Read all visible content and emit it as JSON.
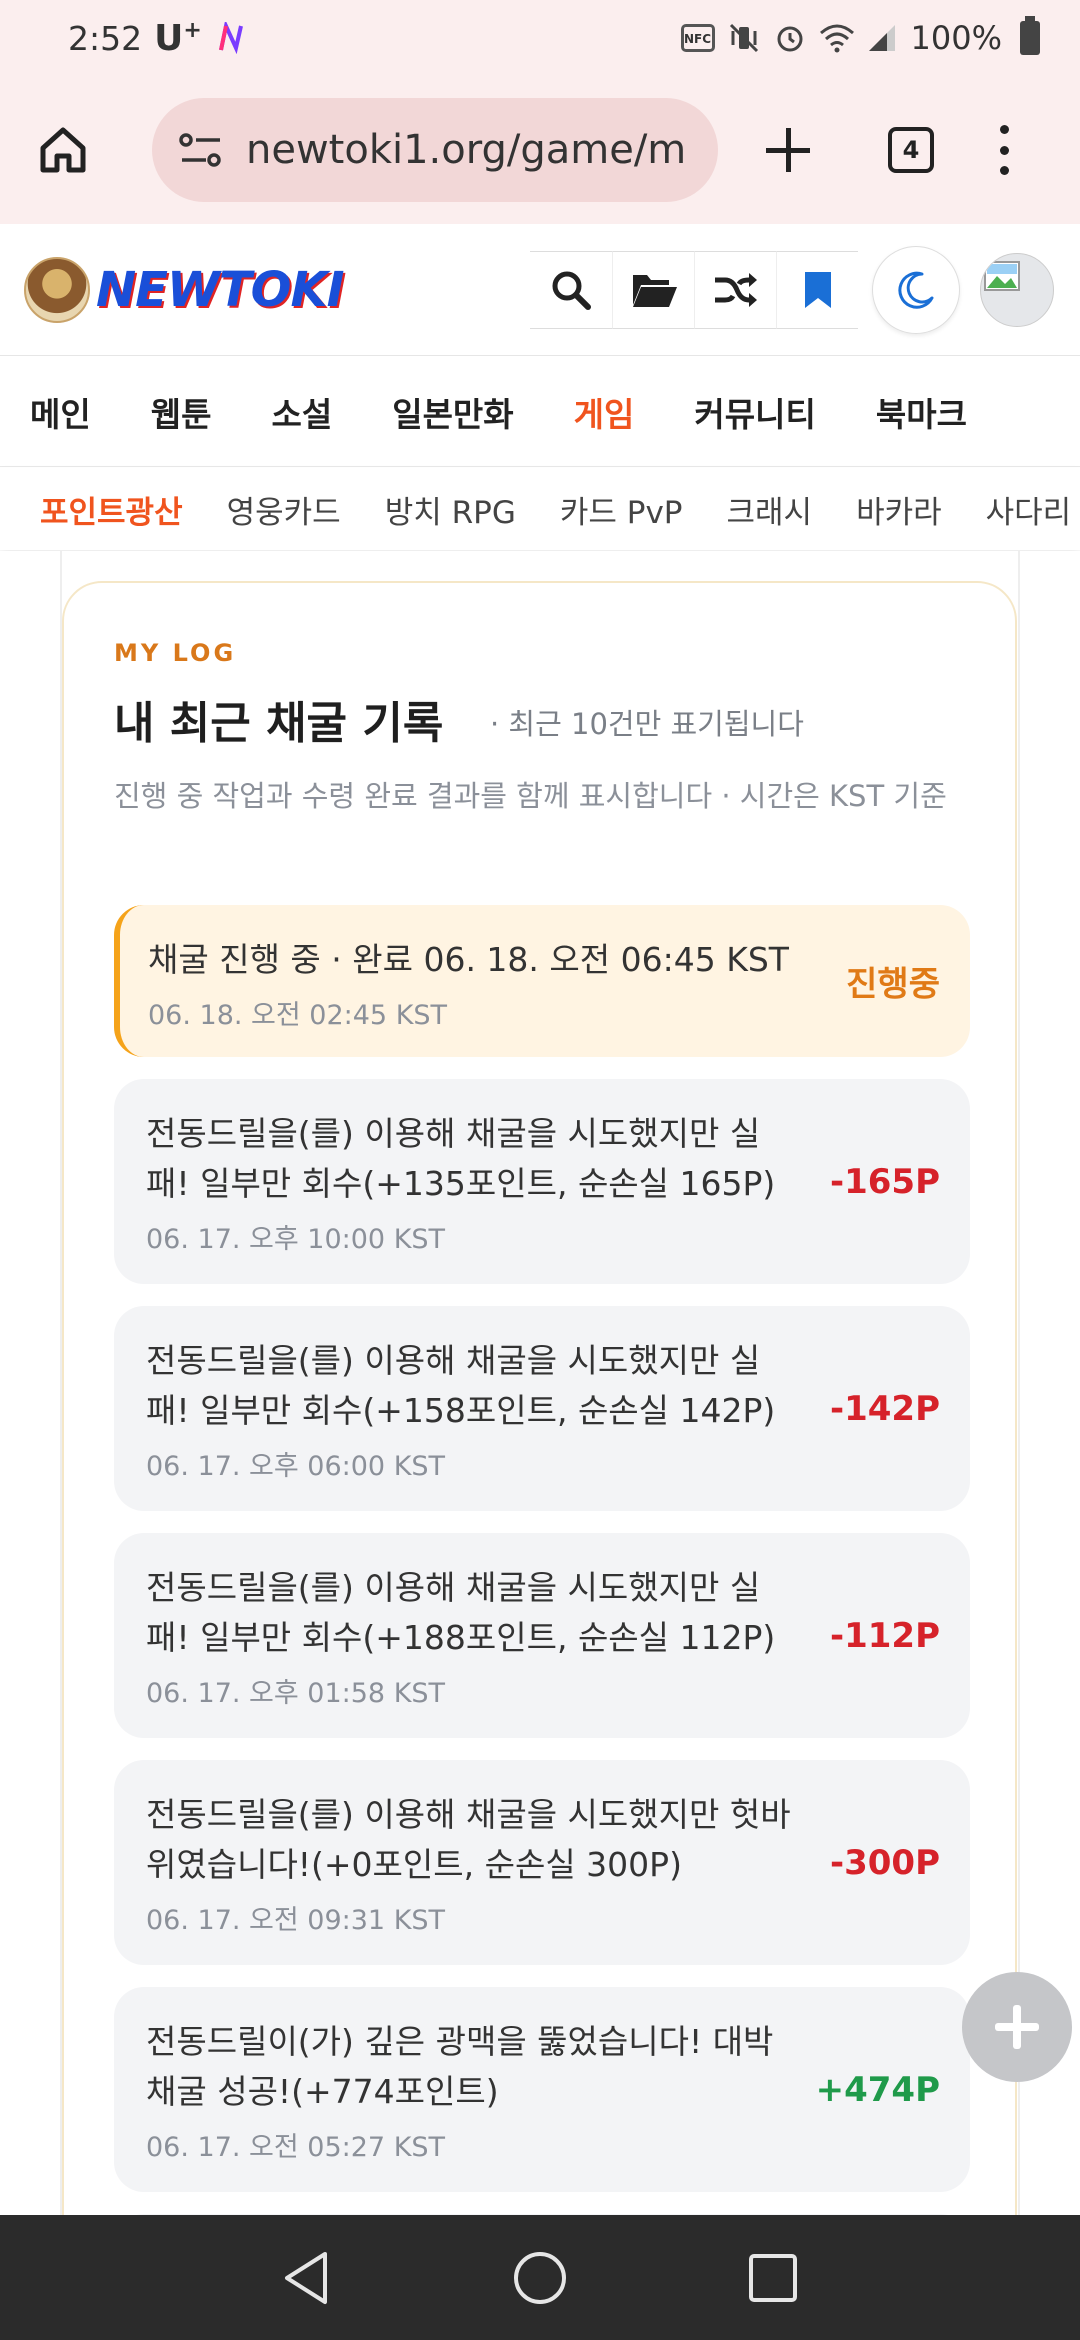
{
  "status_bar": {
    "time": "2:52",
    "carrier": "U",
    "carrier_suffix": "+",
    "battery": "100%"
  },
  "browser": {
    "url": "newtoki1.org/game/m",
    "tab_count": "4"
  },
  "site": {
    "logo_text": "NEWTOKI"
  },
  "main_nav": [
    {
      "label": "메인"
    },
    {
      "label": "웹툰"
    },
    {
      "label": "소설"
    },
    {
      "label": "일본만화"
    },
    {
      "label": "게임"
    },
    {
      "label": "커뮤니티"
    },
    {
      "label": "북마크"
    }
  ],
  "main_nav_active": "게임",
  "sub_nav": [
    {
      "label": "포인트광산"
    },
    {
      "label": "영웅카드"
    },
    {
      "label": "방치 RPG"
    },
    {
      "label": "카드 PvP"
    },
    {
      "label": "크래시"
    },
    {
      "label": "바카라"
    },
    {
      "label": "사다리"
    }
  ],
  "sub_nav_active": "포인트광산",
  "log": {
    "eyebrow": "MY LOG",
    "title": "내 최근 채굴 기록",
    "title_note": "· 최근 10건만 표기됩니다",
    "description": "진행 중 작업과 수령 완료 결과를 함께 표시합니다 · 시간은 KST 기준",
    "entries": [
      {
        "message": "채굴 진행 중 · 완료 06. 18. 오전 06:45 KST",
        "time": "06. 18. 오전 02:45 KST",
        "amount": "진행중",
        "state": "pending"
      },
      {
        "message": "전동드릴을(를) 이용해 채굴을 시도했지만 실패! 일부만 회수(+135포인트, 순손실 165P)",
        "time": "06. 17. 오후 10:00 KST",
        "amount": "-165P",
        "state": "loss"
      },
      {
        "message": "전동드릴을(를) 이용해 채굴을 시도했지만 실패! 일부만 회수(+158포인트, 순손실 142P)",
        "time": "06. 17. 오후 06:00 KST",
        "amount": "-142P",
        "state": "loss"
      },
      {
        "message": "전동드릴을(를) 이용해 채굴을 시도했지만 실패! 일부만 회수(+188포인트, 순손실 112P)",
        "time": "06. 17. 오후 01:58 KST",
        "amount": "-112P",
        "state": "loss"
      },
      {
        "message": "전동드릴을(를) 이용해 채굴을 시도했지만 헛바위였습니다!(+0포인트, 순손실 300P)",
        "time": "06. 17. 오전 09:31 KST",
        "amount": "-300P",
        "state": "loss"
      },
      {
        "message": "전동드릴이(가) 깊은 광맥을 뚫었습니다! 대박 채굴 성공!(+774포인트)",
        "time": "06. 17. 오전 05:27 KST",
        "amount": "+474P",
        "state": "gain"
      }
    ]
  },
  "colors": {
    "accent": "#f0541e",
    "loss": "#d6222a",
    "gain": "#1f9a4a",
    "pending": "#e07a16"
  }
}
